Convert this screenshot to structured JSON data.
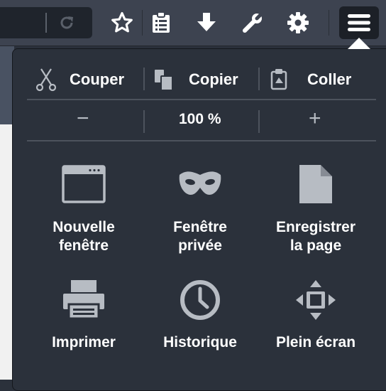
{
  "edit": {
    "cut_label": "Couper",
    "copy_label": "Copier",
    "paste_label": "Coller"
  },
  "zoom": {
    "minus": "−",
    "level": "100 %",
    "plus": "+"
  },
  "tiles": {
    "new_window_line1": "Nouvelle",
    "new_window_line2": "fenêtre",
    "private_window_line1": "Fenêtre",
    "private_window_line2": "privée",
    "save_page_line1": "Enregistrer",
    "save_page_line2": "la page",
    "print": "Imprimer",
    "history": "Historique",
    "fullscreen": "Plein écran"
  },
  "colors": {
    "toolbar": "#3d4350",
    "panel": "#2b313b",
    "icon": "#b7bcc3",
    "text": "#ffffff"
  }
}
